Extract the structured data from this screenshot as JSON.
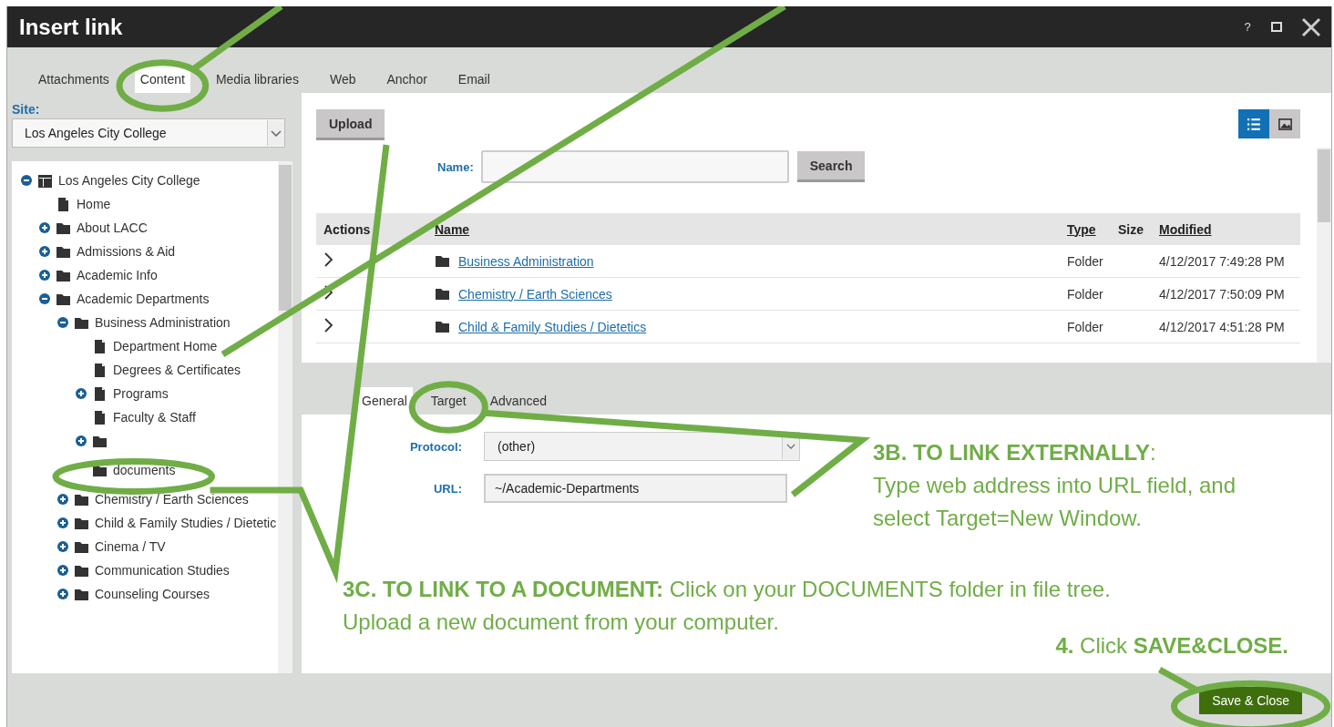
{
  "window": {
    "title": "Insert link",
    "help": "?"
  },
  "tabs": [
    {
      "label": "Attachments",
      "selected": false
    },
    {
      "label": "Content",
      "selected": true
    },
    {
      "label": "Media libraries",
      "selected": false
    },
    {
      "label": "Web",
      "selected": false
    },
    {
      "label": "Anchor",
      "selected": false
    },
    {
      "label": "Email",
      "selected": false
    }
  ],
  "site": {
    "label": "Site:",
    "value": "Los Angeles City College"
  },
  "tree": [
    {
      "label": "Los Angeles City College",
      "kind": "site",
      "expanded": true,
      "children": [
        {
          "label": "Home",
          "kind": "page"
        },
        {
          "label": "About LACC",
          "kind": "folder",
          "expanded": false
        },
        {
          "label": "Admissions & Aid",
          "kind": "folder",
          "expanded": false
        },
        {
          "label": "Academic Info",
          "kind": "folder",
          "expanded": false
        },
        {
          "label": "Academic Departments",
          "kind": "folder",
          "expanded": true,
          "children": [
            {
              "label": "Business Administration",
              "kind": "folder",
              "expanded": true,
              "children": [
                {
                  "label": "Department Home",
                  "kind": "page"
                },
                {
                  "label": "Degrees & Certificates",
                  "kind": "page"
                },
                {
                  "label": "Programs",
                  "kind": "page",
                  "expanded": false
                },
                {
                  "label": "Faculty & Staff",
                  "kind": "page"
                },
                {
                  "kind": "folder",
                  "expanded": false
                },
                {
                  "label": "documents",
                  "kind": "folder"
                }
              ]
            },
            {
              "label": "Chemistry / Earth Sciences",
              "kind": "folder",
              "expanded": false
            },
            {
              "label": "Child & Family Studies / Dietetic",
              "kind": "folder",
              "expanded": false
            },
            {
              "label": "Cinema / TV",
              "kind": "folder",
              "expanded": false
            },
            {
              "label": "Communication Studies",
              "kind": "folder",
              "expanded": false
            },
            {
              "label": "Counseling Courses",
              "kind": "folder",
              "expanded": false
            }
          ]
        }
      ]
    }
  ],
  "browser": {
    "upload": "Upload",
    "views": [
      {
        "kind": "list",
        "selected": true
      },
      {
        "kind": "thumbnails",
        "selected": false
      }
    ],
    "name_label": "Name:",
    "search": "Search",
    "columns": [
      {
        "label": "Actions",
        "sortable": false
      },
      {
        "label": "Name",
        "sortable": true
      },
      {
        "label": "Type",
        "sortable": true
      },
      {
        "label": "Size",
        "sortable": false
      },
      {
        "label": "Modified",
        "sortable": true
      }
    ],
    "rows": [
      {
        "name": "Business Administration",
        "type": "Folder",
        "modified": "4/12/2017 7:49:28 PM"
      },
      {
        "name": "Chemistry / Earth Sciences",
        "type": "Folder",
        "modified": "4/12/2017 7:50:09 PM"
      },
      {
        "name": "Child & Family Studies / Dietetics",
        "type": "Folder",
        "modified": "4/12/2017 4:51:28 PM"
      }
    ]
  },
  "link_tabs": [
    {
      "label": "General",
      "selected": true
    },
    {
      "label": "Target",
      "selected": false
    },
    {
      "label": "Advanced",
      "selected": false
    }
  ],
  "form": [
    {
      "label": "Protocol:",
      "kind": "select",
      "value": "(other)"
    },
    {
      "label": "URL:",
      "kind": "input",
      "value": "~/Academic-Departments"
    }
  ],
  "save_button": "Save & Close",
  "annotations": [
    {
      "lines": [
        "**3B. TO LINK EXTERNALLY**:",
        "Type web address into URL field, and",
        "select Target=New Window."
      ]
    },
    {
      "lines": [
        "**3C. TO LINK TO A DOCUMENT:** Click on your DOCUMENTS folder in file tree.",
        "Upload a new document from your computer."
      ]
    },
    {
      "lines": [
        "**4.** Click **SAVE&CLOSE.**"
      ]
    }
  ]
}
